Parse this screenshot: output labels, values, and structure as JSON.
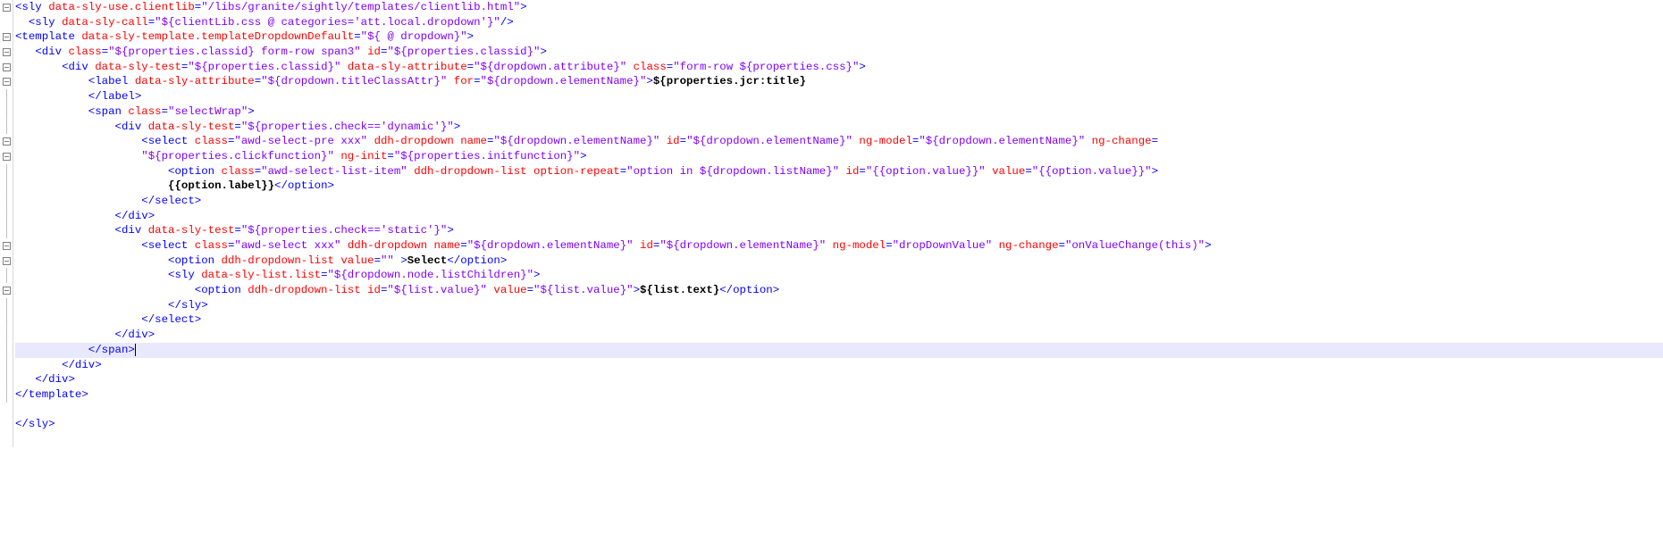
{
  "fold_glyphs": [
    "⊟",
    "",
    "⊟",
    "⊟",
    "⊟",
    "⊟",
    "⊢",
    "⊢",
    "⊢",
    "⊟",
    "⊟",
    "⊢",
    "⊢",
    "⊢",
    "⊢",
    "⊢",
    "⊟",
    "⊟",
    "⊢",
    "⊟",
    "⊢",
    "⊢",
    "⊢",
    "⊢",
    "⊢",
    "⊢",
    "⊢",
    "",
    "",
    ""
  ],
  "highlight_row": 24,
  "lines": [
    [
      [
        "tag",
        "<sly"
      ],
      [
        "plain",
        " "
      ],
      [
        "attr",
        "data-sly-use.clientlib"
      ],
      [
        "tag",
        "="
      ],
      [
        "str",
        "\"/libs/granite/sightly/templates/clientlib.html\""
      ],
      [
        "tag",
        ">"
      ]
    ],
    [
      [
        "plain",
        "  "
      ],
      [
        "tag",
        "<sly"
      ],
      [
        "plain",
        " "
      ],
      [
        "attr",
        "data-sly-call"
      ],
      [
        "tag",
        "="
      ],
      [
        "str",
        "\"${clientLib.css @ categories='att.local.dropdown'}\""
      ],
      [
        "tag",
        "/>"
      ]
    ],
    [
      [
        "tag",
        "<template"
      ],
      [
        "plain",
        " "
      ],
      [
        "attr",
        "data-sly-template.templateDropdownDefault"
      ],
      [
        "tag",
        "="
      ],
      [
        "str",
        "\"${ @ dropdown}\""
      ],
      [
        "tag",
        ">"
      ]
    ],
    [
      [
        "plain",
        "   "
      ],
      [
        "tag",
        "<div"
      ],
      [
        "plain",
        " "
      ],
      [
        "attr",
        "class"
      ],
      [
        "tag",
        "="
      ],
      [
        "str",
        "\"${properties.classid} form-row span3\""
      ],
      [
        "plain",
        " "
      ],
      [
        "attr",
        "id"
      ],
      [
        "tag",
        "="
      ],
      [
        "str",
        "\"${properties.classid}\""
      ],
      [
        "tag",
        ">"
      ]
    ],
    [
      [
        "plain",
        "       "
      ],
      [
        "tag",
        "<div"
      ],
      [
        "plain",
        " "
      ],
      [
        "attr",
        "data-sly-test"
      ],
      [
        "tag",
        "="
      ],
      [
        "str",
        "\"${properties.classid}\""
      ],
      [
        "plain",
        " "
      ],
      [
        "attr",
        "data-sly-attribute"
      ],
      [
        "tag",
        "="
      ],
      [
        "str",
        "\"${dropdown.attribute}\""
      ],
      [
        "plain",
        " "
      ],
      [
        "attr",
        "class"
      ],
      [
        "tag",
        "="
      ],
      [
        "str",
        "\"form-row ${properties.css}\""
      ],
      [
        "tag",
        ">"
      ]
    ],
    [
      [
        "plain",
        "           "
      ],
      [
        "tag",
        "<label"
      ],
      [
        "plain",
        " "
      ],
      [
        "attr",
        "data-sly-attribute"
      ],
      [
        "tag",
        "="
      ],
      [
        "str",
        "\"${dropdown.titleClassAttr}\""
      ],
      [
        "plain",
        " "
      ],
      [
        "attr",
        "for"
      ],
      [
        "tag",
        "="
      ],
      [
        "str",
        "\"${dropdown.elementName}\""
      ],
      [
        "tag",
        ">"
      ],
      [
        "txt",
        "${properties.jcr:title}"
      ]
    ],
    [
      [
        "plain",
        "           "
      ],
      [
        "tag",
        "</label>"
      ]
    ],
    [
      [
        "plain",
        "           "
      ],
      [
        "tag",
        "<span"
      ],
      [
        "plain",
        " "
      ],
      [
        "attr",
        "class"
      ],
      [
        "tag",
        "="
      ],
      [
        "str",
        "\"selectWrap\""
      ],
      [
        "tag",
        ">"
      ]
    ],
    [
      [
        "plain",
        "               "
      ],
      [
        "tag",
        "<div"
      ],
      [
        "plain",
        " "
      ],
      [
        "attr",
        "data-sly-test"
      ],
      [
        "tag",
        "="
      ],
      [
        "str",
        "\"${properties.check=='dynamic'}\""
      ],
      [
        "tag",
        ">"
      ]
    ],
    [
      [
        "plain",
        "                   "
      ],
      [
        "tag",
        "<select"
      ],
      [
        "plain",
        " "
      ],
      [
        "attr",
        "class"
      ],
      [
        "tag",
        "="
      ],
      [
        "str",
        "\"awd-select-pre xxx\""
      ],
      [
        "plain",
        " "
      ],
      [
        "attr",
        "ddh-dropdown"
      ],
      [
        "plain",
        " "
      ],
      [
        "attr",
        "name"
      ],
      [
        "tag",
        "="
      ],
      [
        "str",
        "\"${dropdown.elementName}\""
      ],
      [
        "plain",
        " "
      ],
      [
        "attr",
        "id"
      ],
      [
        "tag",
        "="
      ],
      [
        "str",
        "\"${dropdown.elementName}\""
      ],
      [
        "plain",
        " "
      ],
      [
        "attr",
        "ng-model"
      ],
      [
        "tag",
        "="
      ],
      [
        "str",
        "\"${dropdown.elementName}\""
      ],
      [
        "plain",
        " "
      ],
      [
        "attr",
        "ng-change"
      ],
      [
        "tag",
        "="
      ]
    ],
    [
      [
        "plain",
        "                   "
      ],
      [
        "str",
        "\"${properties.clickfunction}\""
      ],
      [
        "plain",
        " "
      ],
      [
        "attr",
        "ng-init"
      ],
      [
        "tag",
        "="
      ],
      [
        "str",
        "\"${properties.initfunction}\""
      ],
      [
        "tag",
        ">"
      ]
    ],
    [
      [
        "plain",
        "                       "
      ],
      [
        "tag",
        "<option"
      ],
      [
        "plain",
        " "
      ],
      [
        "attr",
        "class"
      ],
      [
        "tag",
        "="
      ],
      [
        "str",
        "\"awd-select-list-item\""
      ],
      [
        "plain",
        " "
      ],
      [
        "attr",
        "ddh-dropdown-list"
      ],
      [
        "plain",
        " "
      ],
      [
        "attr",
        "option-repeat"
      ],
      [
        "tag",
        "="
      ],
      [
        "str",
        "\"option in ${dropdown.listName}\""
      ],
      [
        "plain",
        " "
      ],
      [
        "attr",
        "id"
      ],
      [
        "tag",
        "="
      ],
      [
        "str",
        "\"{{option.value}}\""
      ],
      [
        "plain",
        " "
      ],
      [
        "attr",
        "value"
      ],
      [
        "tag",
        "="
      ],
      [
        "str",
        "\"{{option.value}}\""
      ],
      [
        "tag",
        ">"
      ]
    ],
    [
      [
        "plain",
        "                       "
      ],
      [
        "txt",
        "{{option.label}}"
      ],
      [
        "tag",
        "</option>"
      ]
    ],
    [
      [
        "plain",
        "                   "
      ],
      [
        "tag",
        "</select>"
      ]
    ],
    [
      [
        "plain",
        "               "
      ],
      [
        "tag",
        "</div>"
      ]
    ],
    [
      [
        "plain",
        "               "
      ],
      [
        "tag",
        "<div"
      ],
      [
        "plain",
        " "
      ],
      [
        "attr",
        "data-sly-test"
      ],
      [
        "tag",
        "="
      ],
      [
        "str",
        "\"${properties.check=='static'}\""
      ],
      [
        "tag",
        ">"
      ]
    ],
    [
      [
        "plain",
        "                   "
      ],
      [
        "tag",
        "<select"
      ],
      [
        "plain",
        " "
      ],
      [
        "attr",
        "class"
      ],
      [
        "tag",
        "="
      ],
      [
        "str",
        "\"awd-select xxx\""
      ],
      [
        "plain",
        " "
      ],
      [
        "attr",
        "ddh-dropdown"
      ],
      [
        "plain",
        " "
      ],
      [
        "attr",
        "name"
      ],
      [
        "tag",
        "="
      ],
      [
        "str",
        "\"${dropdown.elementName}\""
      ],
      [
        "plain",
        " "
      ],
      [
        "attr",
        "id"
      ],
      [
        "tag",
        "="
      ],
      [
        "str",
        "\"${dropdown.elementName}\""
      ],
      [
        "plain",
        " "
      ],
      [
        "attr",
        "ng-model"
      ],
      [
        "tag",
        "="
      ],
      [
        "str",
        "\"dropDownValue\""
      ],
      [
        "plain",
        " "
      ],
      [
        "attr",
        "ng-change"
      ],
      [
        "tag",
        "="
      ],
      [
        "str",
        "\"onValueChange(this)\""
      ],
      [
        "tag",
        ">"
      ]
    ],
    [
      [
        "plain",
        "                       "
      ],
      [
        "tag",
        "<option"
      ],
      [
        "plain",
        " "
      ],
      [
        "attr",
        "ddh-dropdown-list"
      ],
      [
        "plain",
        " "
      ],
      [
        "attr",
        "value"
      ],
      [
        "tag",
        "="
      ],
      [
        "str",
        "\"\""
      ],
      [
        "plain",
        " "
      ],
      [
        "tag",
        ">"
      ],
      [
        "txt",
        "Select"
      ],
      [
        "tag",
        "</option>"
      ]
    ],
    [
      [
        "plain",
        "                       "
      ],
      [
        "tag",
        "<sly"
      ],
      [
        "plain",
        " "
      ],
      [
        "attr",
        "data-sly-list.list"
      ],
      [
        "tag",
        "="
      ],
      [
        "str",
        "\"${dropdown.node.listChildren}\""
      ],
      [
        "tag",
        ">"
      ]
    ],
    [
      [
        "plain",
        "                           "
      ],
      [
        "tag",
        "<option"
      ],
      [
        "plain",
        " "
      ],
      [
        "attr",
        "ddh-dropdown-list"
      ],
      [
        "plain",
        " "
      ],
      [
        "attr",
        "id"
      ],
      [
        "tag",
        "="
      ],
      [
        "str",
        "\"${list.value}\""
      ],
      [
        "plain",
        " "
      ],
      [
        "attr",
        "value"
      ],
      [
        "tag",
        "="
      ],
      [
        "str",
        "\"${list.value}\""
      ],
      [
        "tag",
        ">"
      ],
      [
        "txt",
        "${list.text}"
      ],
      [
        "tag",
        "</option>"
      ]
    ],
    [
      [
        "plain",
        "                       "
      ],
      [
        "tag",
        "</sly>"
      ]
    ],
    [
      [
        "plain",
        "                   "
      ],
      [
        "tag",
        "</select>"
      ]
    ],
    [
      [
        "plain",
        "               "
      ],
      [
        "tag",
        "</div>"
      ]
    ],
    [
      [
        "plain",
        "           "
      ],
      [
        "tag",
        "</span>"
      ]
    ],
    [
      [
        "plain",
        "       "
      ],
      [
        "tag",
        "</div>"
      ]
    ],
    [
      [
        "plain",
        "   "
      ],
      [
        "tag",
        "</div>"
      ]
    ],
    [
      [
        "tag",
        "</template>"
      ]
    ],
    [
      [
        "plain",
        " "
      ]
    ],
    [
      [
        "tag",
        "</sly>"
      ]
    ]
  ]
}
